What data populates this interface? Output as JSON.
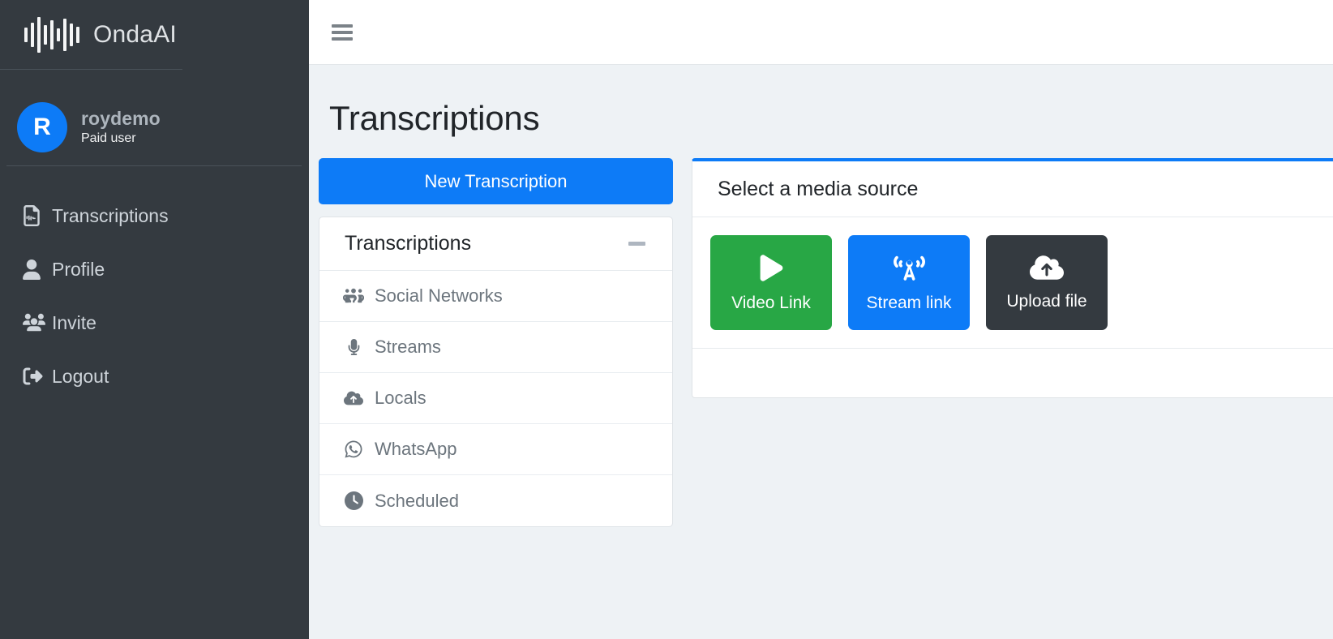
{
  "brand": {
    "name": "OndaAI",
    "logo_icon": "audio-waveform-icon"
  },
  "user": {
    "avatar_initial": "R",
    "name": "roydemo",
    "role": "Paid user",
    "avatar_color": "#0d7bf7"
  },
  "sidebar": {
    "items": [
      {
        "label": "Transcriptions",
        "icon": "file-waveform-icon"
      },
      {
        "label": "Profile",
        "icon": "user-icon"
      },
      {
        "label": "Invite",
        "icon": "users-icon"
      },
      {
        "label": "Logout",
        "icon": "sign-out-icon"
      }
    ]
  },
  "topbar": {
    "menu_icon": "hamburger-menu-icon"
  },
  "page": {
    "title": "Transcriptions"
  },
  "left_panel": {
    "new_button_label": "New Transcription",
    "list_title": "Transcriptions",
    "collapse_icon": "minus-icon",
    "items": [
      {
        "label": "Social Networks",
        "icon": "users-group-icon"
      },
      {
        "label": "Streams",
        "icon": "microphone-icon"
      },
      {
        "label": "Locals",
        "icon": "upload-icon"
      },
      {
        "label": "WhatsApp",
        "icon": "whatsapp-icon"
      },
      {
        "label": "Scheduled",
        "icon": "clock-icon"
      }
    ]
  },
  "media_card": {
    "title": "Select a media source",
    "accent_color": "#0d7bf7",
    "sources": [
      {
        "label": "Video Link",
        "icon": "play-icon",
        "color": "#28a745"
      },
      {
        "label": "Stream link",
        "icon": "broadcast-tower-icon",
        "color": "#0d7bf7"
      },
      {
        "label": "Upload file",
        "icon": "cloud-upload-icon",
        "color": "#343a40"
      }
    ]
  }
}
